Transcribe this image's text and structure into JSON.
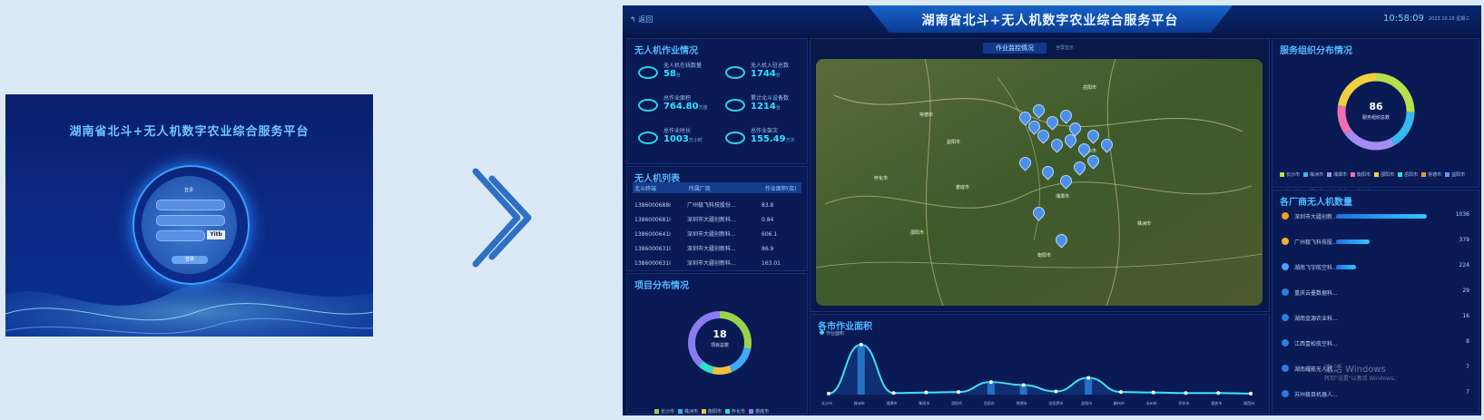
{
  "login": {
    "title": "湖南省北斗+无人机数字农业综合服务平台",
    "form_title": "登录",
    "captcha": "Yitb",
    "submit": "登录"
  },
  "header": {
    "back": "返回",
    "title": "湖南省北斗+无人机数字农业综合服务平台",
    "clock": "10:58:09",
    "date": "2023.10.18 星期三"
  },
  "ops": {
    "title": "无人机作业情况",
    "stats": [
      {
        "label": "无人机在线数量",
        "value": "58",
        "unit": "台"
      },
      {
        "label": "无人机入驻总数",
        "value": "1744",
        "unit": "台"
      },
      {
        "label": "总作业面积",
        "value": "764.80",
        "unit": "万亩"
      },
      {
        "label": "累计北斗设备数",
        "value": "1214",
        "unit": "台"
      },
      {
        "label": "总作业时长",
        "value": "1003",
        "unit": "万小时"
      },
      {
        "label": "总作业架次",
        "value": "155.49",
        "unit": "万次"
      }
    ]
  },
  "uav_list": {
    "title": "无人机列表",
    "headers": [
      "北斗终端",
      "所属厂商",
      "作业面积(亩)"
    ],
    "rows": [
      [
        "1386000688I",
        "广州极飞科技股份...",
        "83.8"
      ],
      [
        "1386000681I",
        "深圳市大疆创新科...",
        "0.84"
      ],
      [
        "1386000641I",
        "深圳市大疆创新科...",
        "606.1"
      ],
      [
        "1386000631I",
        "深圳市大疆创新科...",
        "86.9"
      ],
      [
        "1386000631I",
        "深圳市大疆创新科...",
        "163.01"
      ]
    ]
  },
  "projects": {
    "title": "项目分布情况",
    "total": "18",
    "total_label": "项目总数",
    "legend": [
      "长沙市",
      "株洲市",
      "衡阳市",
      "怀化市",
      "娄底市"
    ]
  },
  "map": {
    "tab_active": "作业监控情况",
    "tab_other": "全屏显示",
    "labels": [
      "常德市",
      "益阳市",
      "长沙市",
      "娄底市",
      "湘潭市",
      "邵阳市",
      "衡阳市",
      "株洲市",
      "怀化市",
      "岳阳市"
    ]
  },
  "city_area": {
    "title": "各市作业面积",
    "legend": "作业面积",
    "cities": [
      "长沙市",
      "株洲市",
      "湘潭市",
      "衡阳市",
      "邵阳市",
      "岳阳市",
      "常德市",
      "张家界市",
      "益阳市",
      "郴州市",
      "永州市",
      "怀化市",
      "娄底市",
      "湘西州"
    ],
    "values": [
      2,
      95,
      3,
      4,
      5,
      24,
      18,
      6,
      32,
      5,
      4,
      3,
      3,
      2
    ]
  },
  "service_org": {
    "title": "服务组织分布情况",
    "total": "86",
    "total_label": "服务组织总数",
    "legend": [
      "长沙市",
      "株洲市",
      "湘潭市",
      "衡阳市",
      "邵阳市",
      "岳阳市",
      "常德市",
      "益阳市",
      "永州市",
      "郴州市",
      "怀化市",
      "娄底市"
    ]
  },
  "vendors": {
    "title": "各厂商无人机数量",
    "rows": [
      {
        "name": "深圳市大疆创新...",
        "value": "1036",
        "ratio": 1.0,
        "color": "#f0a020"
      },
      {
        "name": "广州极飞科技股...",
        "value": "379",
        "ratio": 0.37,
        "color": "#f0b030"
      },
      {
        "name": "湖南飞宇航空科...",
        "value": "224",
        "ratio": 0.22,
        "color": "#4aa0ff"
      },
      {
        "name": "重庆云墨数据科...",
        "value": "29",
        "ratio": 0,
        "color": "#2b7de0"
      },
      {
        "name": "湖南金源农业科...",
        "value": "16",
        "ratio": 0,
        "color": "#2b7de0"
      },
      {
        "name": "江西壹松航空科...",
        "value": "8",
        "ratio": 0,
        "color": "#2b7de0"
      },
      {
        "name": "湖南耀能无人机...",
        "value": "7",
        "ratio": 0,
        "color": "#2b7de0"
      },
      {
        "name": "苏州极目机器人...",
        "value": "7",
        "ratio": 0,
        "color": "#2b7de0"
      }
    ]
  },
  "watermark": {
    "line1": "激活 Windows",
    "line2": "转到\"设置\"以激活 Windows。"
  }
}
